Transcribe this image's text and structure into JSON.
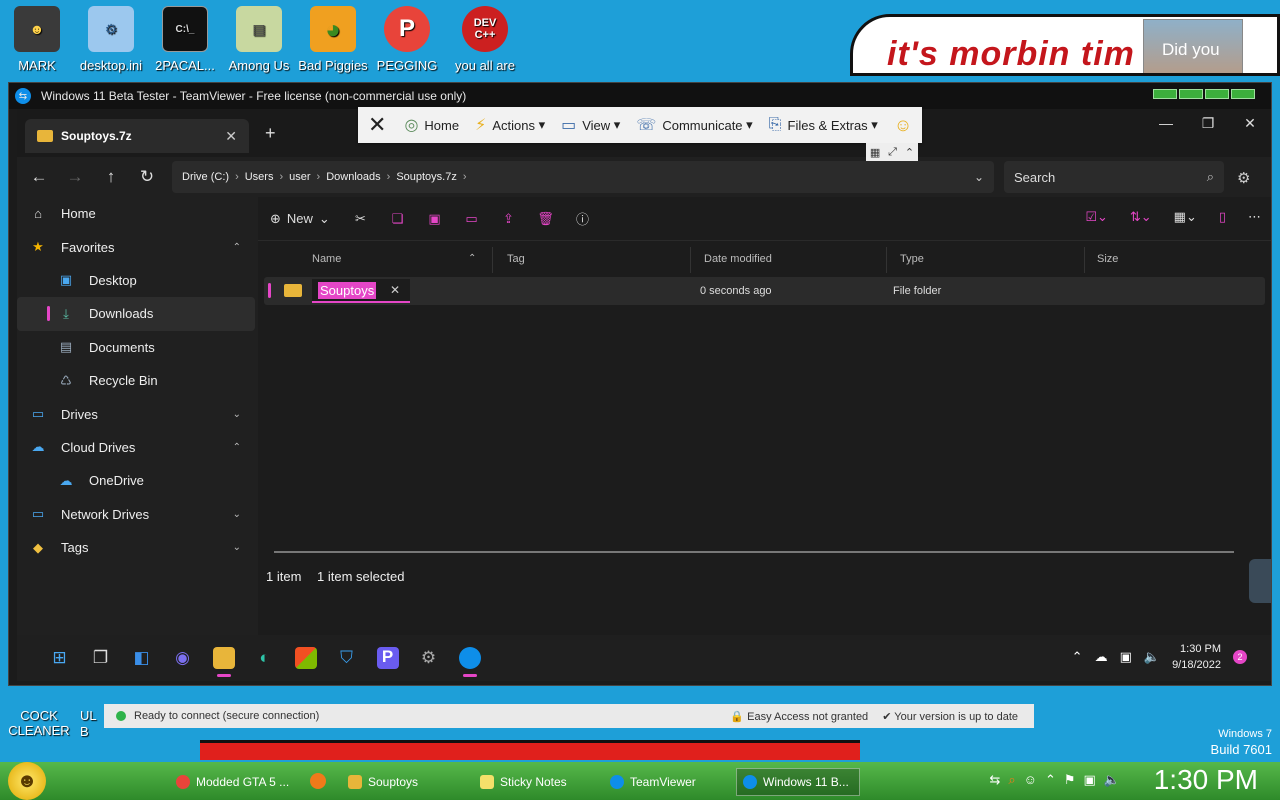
{
  "desktop": {
    "icons": [
      {
        "label": "MARK",
        "color": "#ffd24a",
        "glyph": "☻"
      },
      {
        "label": "desktop.ini",
        "color": "#9cc8ee",
        "glyph": "⚙"
      },
      {
        "label": "2PACAL...",
        "color": "#111111",
        "glyph": "C:\\_"
      },
      {
        "label": "Among Us",
        "color": "#c8d8a0",
        "glyph": "▤"
      },
      {
        "label": "Bad Piggies",
        "color": "#7ac043",
        "glyph": "◕"
      },
      {
        "label": "PEGGING",
        "color": "#e8443a",
        "glyph": "P"
      },
      {
        "label": "you all are",
        "color": "#cc2020",
        "glyph": "DEV C++"
      }
    ],
    "banner_text": "it's morbin  tim",
    "banner_photo_caption": "Did you",
    "bottom_left_icon": "COCK CLEANER",
    "bottom_left_partial": "UL B",
    "win7": {
      "line1": "Windows 7",
      "line2": "Build 7601"
    }
  },
  "teamviewer": {
    "title": "Windows 11 Beta Tester - TeamViewer - Free license (non-commercial use only)",
    "toolbar": {
      "home": "Home",
      "actions": "Actions",
      "view": "View",
      "communicate": "Communicate",
      "files_extras": "Files & Extras"
    },
    "status": {
      "connection": "Ready to connect (secure connection)",
      "easy_access": "Easy Access not granted",
      "version": "Your version is up to date"
    }
  },
  "files": {
    "tab_title": "Souptoys.7z",
    "breadcrumb": [
      "Drive (C:)",
      "Users",
      "user",
      "Downloads",
      "Souptoys.7z"
    ],
    "search_placeholder": "Search",
    "new_label": "New",
    "sidebar": [
      {
        "label": "Home",
        "icon": "⌂",
        "sub": false,
        "chev": ""
      },
      {
        "label": "Favorites",
        "icon": "★",
        "sub": false,
        "chev": "⌃"
      },
      {
        "label": "Desktop",
        "icon": "▣",
        "sub": true,
        "chev": ""
      },
      {
        "label": "Downloads",
        "icon": "⤓",
        "sub": true,
        "chev": "",
        "selected": true
      },
      {
        "label": "Documents",
        "icon": "▤",
        "sub": true,
        "chev": ""
      },
      {
        "label": "Recycle Bin",
        "icon": "♺",
        "sub": true,
        "chev": ""
      },
      {
        "label": "Drives",
        "icon": "▭",
        "sub": false,
        "chev": "⌄"
      },
      {
        "label": "Cloud Drives",
        "icon": "☁",
        "sub": false,
        "chev": "⌃"
      },
      {
        "label": "OneDrive",
        "icon": "☁",
        "sub": true,
        "chev": ""
      },
      {
        "label": "Network Drives",
        "icon": "▭",
        "sub": false,
        "chev": "⌄"
      },
      {
        "label": "Tags",
        "icon": "◆",
        "sub": false,
        "chev": "⌄"
      }
    ],
    "columns": {
      "name": "Name",
      "tag": "Tag",
      "date": "Date modified",
      "type": "Type",
      "size": "Size"
    },
    "rows": [
      {
        "name": "Souptoys",
        "date": "0 seconds ago",
        "type": "File folder",
        "size": ""
      }
    ],
    "status": {
      "count": "1 item",
      "selected": "1 item selected"
    }
  },
  "remote_taskbar": {
    "time": "1:30 PM",
    "date": "9/18/2022",
    "badge": "2"
  },
  "host_taskbar": {
    "tasks": [
      "Modded GTA 5 ...",
      "Souptoys",
      "Sticky Notes",
      "TeamViewer",
      "Windows 11 B..."
    ],
    "time": "1:30 PM"
  },
  "colors": {
    "accent": "#e546c7",
    "folder": "#e8b53a",
    "host_taskbar": "#3ba034"
  }
}
